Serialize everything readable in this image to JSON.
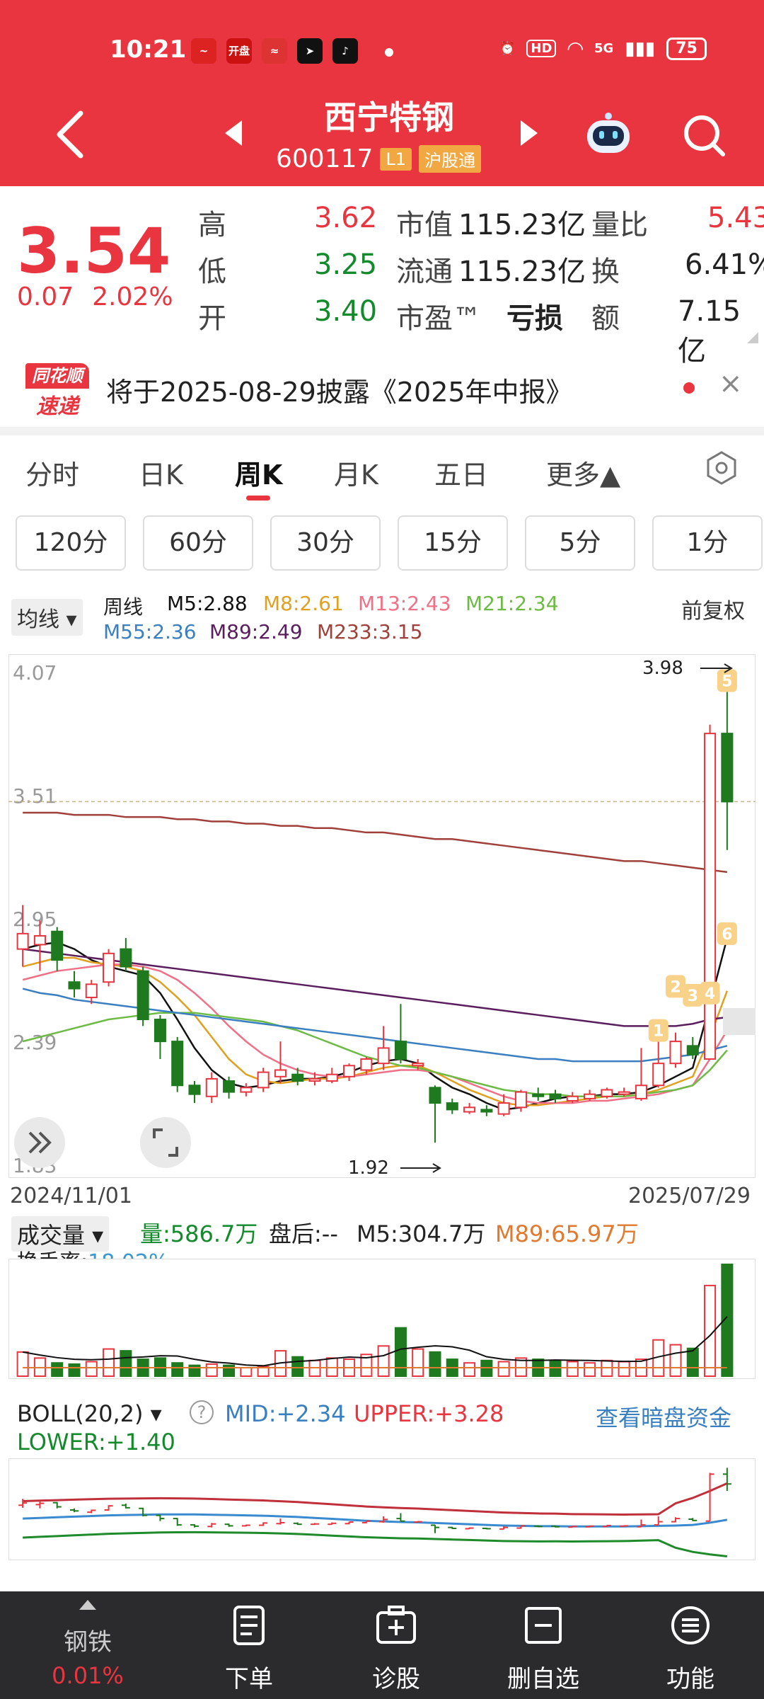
{
  "status": {
    "time": "10:21",
    "app_icons": [
      "quote-app-icon",
      "kaipan-app-icon",
      "stock-app-icon",
      "arrow-app-icon",
      "tiktok-app-icon"
    ],
    "app_icon_labels": [
      "",
      "开盘",
      "",
      "",
      ""
    ],
    "hd": "HD",
    "network": "5G",
    "battery": "75"
  },
  "header": {
    "name": "西宁特钢",
    "code": "600117",
    "level": "L1",
    "connect": "沪股通"
  },
  "quote": {
    "price": "3.54",
    "change": "0.07",
    "change_pct": "2.02%",
    "rows": [
      {
        "l1": "高",
        "v1": "3.62",
        "l2": "市值",
        "v2": "115.23亿",
        "l3": "量比",
        "v3": "5.43"
      },
      {
        "l1": "低",
        "v1": "3.25",
        "l2": "流通",
        "v2": "115.23亿",
        "l3": "换",
        "v3": "6.41%"
      },
      {
        "l1": "开",
        "v1": "3.40",
        "l2": "市盈™",
        "v2": "亏损",
        "l3": "额",
        "v3": "7.15亿"
      }
    ]
  },
  "notice": {
    "logo_top": "同花顺",
    "logo_bottom": "速递",
    "text": "将于2025-08-29披露《2025年中报》",
    "close": "×"
  },
  "tabs": [
    "分时",
    "日K",
    "周K",
    "月K",
    "五日",
    "更多▲"
  ],
  "intervals": [
    "120分",
    "60分",
    "30分",
    "15分",
    "5分",
    "1分"
  ],
  "ma_legend": {
    "selector": "均线 ▾",
    "period": "周线",
    "items": [
      {
        "label": "M5:2.88",
        "color": "#111111"
      },
      {
        "label": "M8:2.61",
        "color": "#e0a020"
      },
      {
        "label": "M13:2.43",
        "color": "#f07088"
      },
      {
        "label": "M21:2.34",
        "color": "#6dbb45"
      },
      {
        "label": "M55:2.36",
        "color": "#3a7fc0"
      },
      {
        "label": "M89:2.49",
        "color": "#5a1e5e"
      },
      {
        "label": "M233:3.15",
        "color": "#a0403a"
      }
    ],
    "adjust": "前复权"
  },
  "chart_data": {
    "type": "candlestick",
    "y_labels": [
      "4.07",
      "3.51",
      "2.95",
      "2.39",
      "1.83"
    ],
    "ylim": [
      1.83,
      4.07
    ],
    "high_annotation": "3.98",
    "low_annotation": "1.92",
    "date_start": "2024/11/01",
    "date_end": "2025/07/29",
    "markers": [
      "1",
      "2",
      "3",
      "4",
      "5",
      "6"
    ],
    "candles": [
      {
        "o": 2.8,
        "c": 2.87,
        "h": 3.0,
        "l": 2.72
      },
      {
        "o": 2.82,
        "c": 2.86,
        "h": 2.93,
        "l": 2.7
      },
      {
        "o": 2.88,
        "c": 2.75,
        "h": 2.9,
        "l": 2.7
      },
      {
        "o": 2.65,
        "c": 2.62,
        "h": 2.7,
        "l": 2.58
      },
      {
        "o": 2.58,
        "c": 2.64,
        "h": 2.66,
        "l": 2.55
      },
      {
        "o": 2.65,
        "c": 2.78,
        "h": 2.8,
        "l": 2.63
      },
      {
        "o": 2.8,
        "c": 2.72,
        "h": 2.85,
        "l": 2.7
      },
      {
        "o": 2.7,
        "c": 2.48,
        "h": 2.72,
        "l": 2.45
      },
      {
        "o": 2.48,
        "c": 2.38,
        "h": 2.5,
        "l": 2.3
      },
      {
        "o": 2.38,
        "c": 2.18,
        "h": 2.4,
        "l": 2.15
      },
      {
        "o": 2.18,
        "c": 2.14,
        "h": 2.2,
        "l": 2.1
      },
      {
        "o": 2.13,
        "c": 2.21,
        "h": 2.24,
        "l": 2.1
      },
      {
        "o": 2.2,
        "c": 2.15,
        "h": 2.22,
        "l": 2.12
      },
      {
        "o": 2.15,
        "c": 2.17,
        "h": 2.19,
        "l": 2.13
      },
      {
        "o": 2.17,
        "c": 2.24,
        "h": 2.26,
        "l": 2.15
      },
      {
        "o": 2.22,
        "c": 2.25,
        "h": 2.38,
        "l": 2.19
      },
      {
        "o": 2.23,
        "c": 2.2,
        "h": 2.26,
        "l": 2.18
      },
      {
        "o": 2.2,
        "c": 2.21,
        "h": 2.24,
        "l": 2.18
      },
      {
        "o": 2.2,
        "c": 2.23,
        "h": 2.26,
        "l": 2.19
      },
      {
        "o": 2.22,
        "c": 2.27,
        "h": 2.28,
        "l": 2.2
      },
      {
        "o": 2.25,
        "c": 2.3,
        "h": 2.31,
        "l": 2.23
      },
      {
        "o": 2.28,
        "c": 2.35,
        "h": 2.45,
        "l": 2.25
      },
      {
        "o": 2.38,
        "c": 2.3,
        "h": 2.55,
        "l": 2.28
      },
      {
        "o": 2.27,
        "c": 2.28,
        "h": 2.3,
        "l": 2.25
      },
      {
        "o": 2.17,
        "c": 2.1,
        "h": 2.18,
        "l": 1.92
      },
      {
        "o": 2.1,
        "c": 2.07,
        "h": 2.12,
        "l": 2.05
      },
      {
        "o": 2.06,
        "c": 2.08,
        "h": 2.1,
        "l": 2.05
      },
      {
        "o": 2.07,
        "c": 2.06,
        "h": 2.09,
        "l": 2.04
      },
      {
        "o": 2.05,
        "c": 2.1,
        "h": 2.14,
        "l": 2.04
      },
      {
        "o": 2.08,
        "c": 2.15,
        "h": 2.16,
        "l": 2.06
      },
      {
        "o": 2.14,
        "c": 2.13,
        "h": 2.17,
        "l": 2.11
      },
      {
        "o": 2.14,
        "c": 2.12,
        "h": 2.16,
        "l": 2.1
      },
      {
        "o": 2.11,
        "c": 2.13,
        "h": 2.15,
        "l": 2.1
      },
      {
        "o": 2.12,
        "c": 2.14,
        "h": 2.16,
        "l": 2.11
      },
      {
        "o": 2.13,
        "c": 2.16,
        "h": 2.17,
        "l": 2.12
      },
      {
        "o": 2.14,
        "c": 2.15,
        "h": 2.17,
        "l": 2.13
      },
      {
        "o": 2.12,
        "c": 2.18,
        "h": 2.35,
        "l": 2.11
      },
      {
        "o": 2.18,
        "c": 2.28,
        "h": 2.45,
        "l": 2.17
      },
      {
        "o": 2.28,
        "c": 2.38,
        "h": 2.42,
        "l": 2.26
      },
      {
        "o": 2.36,
        "c": 2.32,
        "h": 2.4,
        "l": 2.3
      },
      {
        "o": 2.3,
        "c": 3.78,
        "h": 3.82,
        "l": 2.3
      },
      {
        "o": 3.78,
        "c": 3.47,
        "h": 3.98,
        "l": 3.25
      }
    ],
    "ma_lines": [
      {
        "name": "M5",
        "color": "#111111",
        "values": [
          2.8,
          2.82,
          2.83,
          2.8,
          2.75,
          2.72,
          2.7,
          2.68,
          2.6,
          2.48,
          2.35,
          2.25,
          2.19,
          2.17,
          2.18,
          2.2,
          2.21,
          2.21,
          2.22,
          2.24,
          2.27,
          2.29,
          2.3,
          2.28,
          2.22,
          2.17,
          2.14,
          2.1,
          2.07,
          2.08,
          2.1,
          2.12,
          2.13,
          2.13,
          2.14,
          2.14,
          2.15,
          2.18,
          2.22,
          2.26,
          2.55,
          2.85
        ]
      },
      {
        "name": "M8",
        "color": "#e0a020",
        "values": [
          2.72,
          2.74,
          2.76,
          2.76,
          2.74,
          2.73,
          2.72,
          2.7,
          2.65,
          2.58,
          2.5,
          2.4,
          2.3,
          2.23,
          2.2,
          2.19,
          2.2,
          2.21,
          2.21,
          2.22,
          2.24,
          2.26,
          2.27,
          2.27,
          2.24,
          2.2,
          2.16,
          2.13,
          2.1,
          2.09,
          2.09,
          2.1,
          2.11,
          2.12,
          2.13,
          2.13,
          2.14,
          2.16,
          2.19,
          2.22,
          2.4,
          2.61
        ]
      },
      {
        "name": "M13",
        "color": "#f07088",
        "values": [
          2.66,
          2.68,
          2.7,
          2.71,
          2.72,
          2.73,
          2.73,
          2.72,
          2.7,
          2.66,
          2.6,
          2.53,
          2.45,
          2.38,
          2.32,
          2.28,
          2.25,
          2.23,
          2.22,
          2.22,
          2.23,
          2.24,
          2.25,
          2.25,
          2.24,
          2.22,
          2.19,
          2.16,
          2.13,
          2.11,
          2.1,
          2.1,
          2.1,
          2.11,
          2.11,
          2.12,
          2.13,
          2.14,
          2.16,
          2.18,
          2.3,
          2.43
        ]
      },
      {
        "name": "M21",
        "color": "#6dbb45",
        "values": [
          2.38,
          2.4,
          2.42,
          2.44,
          2.46,
          2.48,
          2.49,
          2.5,
          2.51,
          2.51,
          2.51,
          2.5,
          2.49,
          2.48,
          2.47,
          2.45,
          2.43,
          2.4,
          2.37,
          2.34,
          2.31,
          2.29,
          2.27,
          2.26,
          2.24,
          2.22,
          2.2,
          2.18,
          2.16,
          2.15,
          2.14,
          2.14,
          2.13,
          2.13,
          2.13,
          2.13,
          2.14,
          2.15,
          2.16,
          2.18,
          2.25,
          2.34
        ]
      },
      {
        "name": "M55",
        "color": "#3a7fc0",
        "values": [
          2.62,
          2.6,
          2.59,
          2.57,
          2.56,
          2.55,
          2.54,
          2.53,
          2.52,
          2.51,
          2.5,
          2.49,
          2.48,
          2.47,
          2.46,
          2.45,
          2.44,
          2.43,
          2.42,
          2.41,
          2.4,
          2.39,
          2.38,
          2.37,
          2.36,
          2.35,
          2.34,
          2.33,
          2.32,
          2.31,
          2.3,
          2.3,
          2.29,
          2.29,
          2.29,
          2.29,
          2.29,
          2.3,
          2.31,
          2.32,
          2.34,
          2.36
        ]
      },
      {
        "name": "M89",
        "color": "#5a1e5e",
        "values": [
          2.8,
          2.79,
          2.78,
          2.77,
          2.76,
          2.75,
          2.74,
          2.73,
          2.72,
          2.71,
          2.7,
          2.69,
          2.68,
          2.67,
          2.66,
          2.65,
          2.64,
          2.63,
          2.62,
          2.61,
          2.6,
          2.59,
          2.58,
          2.57,
          2.56,
          2.55,
          2.54,
          2.53,
          2.52,
          2.51,
          2.5,
          2.49,
          2.48,
          2.47,
          2.46,
          2.45,
          2.45,
          2.45,
          2.45,
          2.46,
          2.48,
          2.49
        ]
      },
      {
        "name": "M233",
        "color": "#a0403a",
        "values": [
          3.42,
          3.42,
          3.42,
          3.41,
          3.41,
          3.41,
          3.4,
          3.4,
          3.4,
          3.39,
          3.39,
          3.38,
          3.38,
          3.37,
          3.37,
          3.36,
          3.36,
          3.35,
          3.35,
          3.34,
          3.33,
          3.33,
          3.32,
          3.31,
          3.3,
          3.3,
          3.29,
          3.28,
          3.27,
          3.26,
          3.25,
          3.24,
          3.23,
          3.22,
          3.21,
          3.2,
          3.2,
          3.19,
          3.18,
          3.17,
          3.16,
          3.15
        ]
      }
    ],
    "reference_line": 3.47,
    "volume": {
      "label": "成交量 ▾",
      "qty": "量:586.7万",
      "after": "盘后:--",
      "m5": "M5:304.7万",
      "m89": "M89:65.97万",
      "turnover_label": "换手率:",
      "turnover": "18.02%",
      "values": [
        40,
        30,
        22,
        20,
        24,
        45,
        42,
        28,
        30,
        22,
        18,
        20,
        18,
        14,
        16,
        42,
        32,
        26,
        30,
        28,
        36,
        50,
        80,
        45,
        40,
        28,
        22,
        26,
        24,
        30,
        28,
        26,
        24,
        22,
        26,
        24,
        28,
        60,
        52,
        46,
        150,
        185
      ]
    },
    "boll": {
      "label": "BOLL(20,2) ▾",
      "help": "?",
      "mid": "MID:+2.34",
      "upper": "UPPER:+3.28",
      "lower": "LOWER:+1.40",
      "link": "查看暗盘资金"
    }
  },
  "nav": {
    "sector": "钢铁",
    "sector_pct": "0.01%",
    "items": [
      "下单",
      "诊股",
      "删自选",
      "功能"
    ]
  },
  "colors": {
    "brand": "#e8353f",
    "up": "#e8353f",
    "down": "#1f7a1f"
  }
}
